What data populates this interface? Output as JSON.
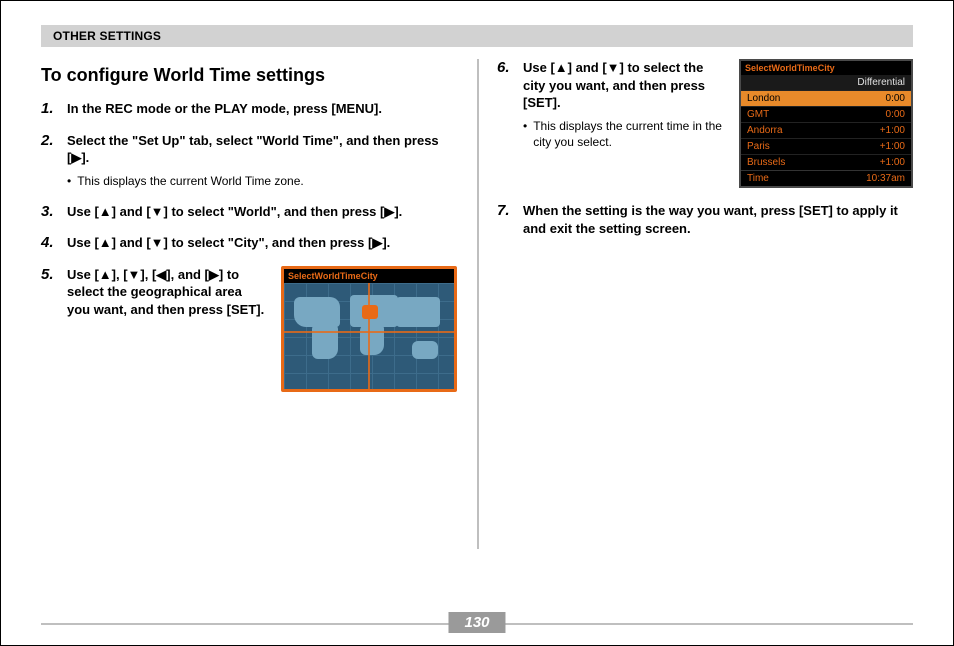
{
  "header": "OTHER SETTINGS",
  "title": "To configure World Time settings",
  "steps": {
    "s1": "In the REC mode or the PLAY mode, press [MENU].",
    "s2": "Select the \"Set Up\" tab, select \"World Time\", and then press [▶].",
    "s2_sub": "This displays the current World Time zone.",
    "s3": "Use [▲] and [▼] to select \"World\", and then press [▶].",
    "s4": "Use [▲] and [▼] to select \"City\", and then press [▶].",
    "s5": "Use [▲], [▼], [◀], and [▶] to select the geographical area you want, and then press [SET].",
    "s6": "Use [▲] and [▼] to select the city you want, and then press [SET].",
    "s6_sub": "This displays the current time in the city you select.",
    "s7": "When the setting is the way you want, press [SET] to apply it and exit the setting screen."
  },
  "map": {
    "title": "SelectWorldTimeCity"
  },
  "list": {
    "title": "SelectWorldTimeCity",
    "subtitle": "Differential",
    "rows": [
      {
        "city": "London",
        "diff": "0:00",
        "selected": true
      },
      {
        "city": "GMT",
        "diff": "0:00"
      },
      {
        "city": "Andorra",
        "diff": "+1:00"
      },
      {
        "city": "Paris",
        "diff": "+1:00"
      },
      {
        "city": "Brussels",
        "diff": "+1:00"
      }
    ],
    "footer_label": "Time",
    "footer_value": "10:37am"
  },
  "page_number": "130"
}
